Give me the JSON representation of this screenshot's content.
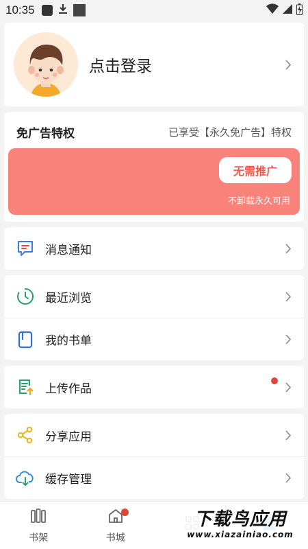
{
  "status_bar": {
    "time": "10:35"
  },
  "profile": {
    "login_label": "点击登录"
  },
  "ad_privilege": {
    "title": "免广告特权",
    "status": "已享受【永久免广告】特权",
    "button_label": "无需推广",
    "note": "不卸载永久可用"
  },
  "menu": {
    "group1": [
      {
        "label": "消息通知",
        "icon": "message-icon"
      }
    ],
    "group2": [
      {
        "label": "最近浏览",
        "icon": "clock-icon"
      },
      {
        "label": "我的书单",
        "icon": "booklist-icon"
      }
    ],
    "group3": [
      {
        "label": "上传作品",
        "icon": "upload-icon",
        "badge": true
      }
    ],
    "group4": [
      {
        "label": "分享应用",
        "icon": "share-icon"
      },
      {
        "label": "缓存管理",
        "icon": "cloud-download-icon"
      }
    ]
  },
  "bottom_nav": {
    "items": [
      {
        "label": "书架",
        "icon": "bookshelf-icon"
      },
      {
        "label": "书城",
        "icon": "home-icon",
        "badge": true
      },
      {
        "label": "",
        "icon": "category-icon"
      },
      {
        "label": "",
        "icon": "profile-icon"
      }
    ]
  },
  "watermark": {
    "main": "下载鸟应用",
    "sub": "www.xiazainiao.com"
  },
  "colors": {
    "accent": "#f9837a",
    "button_text": "#f05a4c",
    "badge": "#e0453a"
  }
}
